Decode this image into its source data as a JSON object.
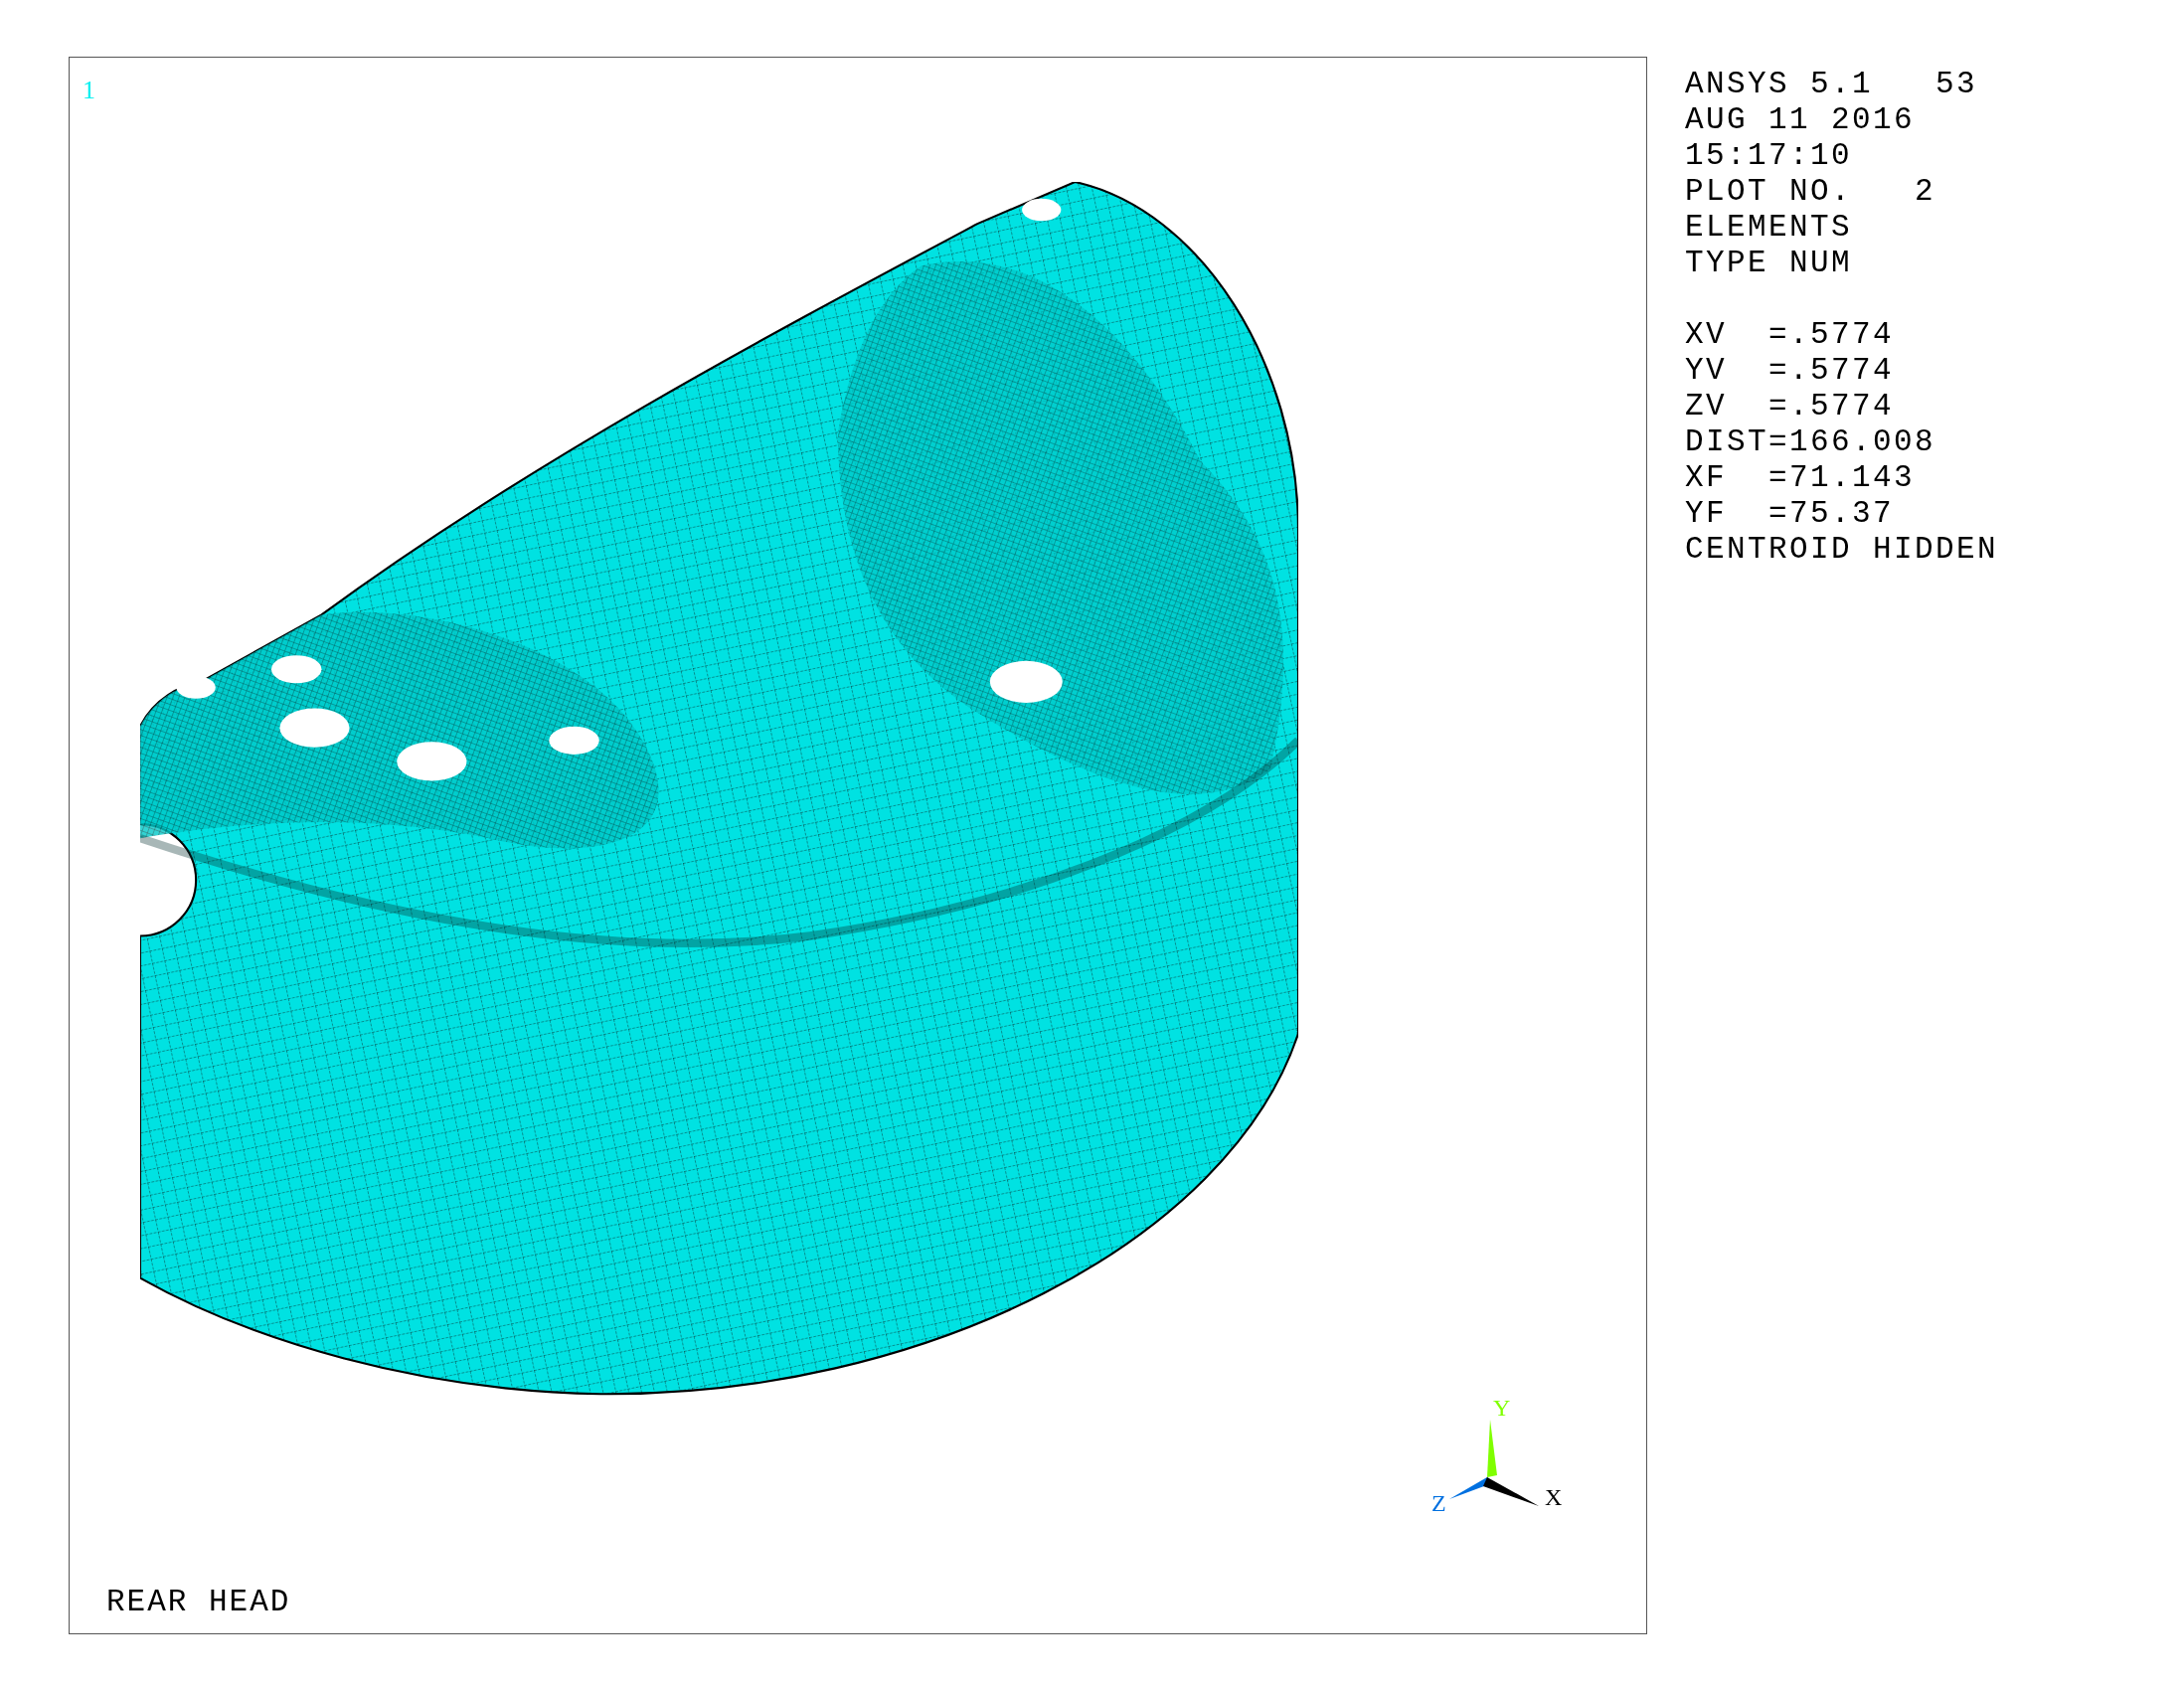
{
  "viewport_number": "1",
  "plot_title": "REAR HEAD",
  "info_groups": [
    [
      "ANSYS 5.1   53",
      "AUG 11 2016",
      "15:17:10",
      "PLOT NO.   2",
      "ELEMENTS",
      "TYPE NUM"
    ],
    [
      "XV  =.5774",
      "YV  =.5774",
      "ZV  =.5774",
      "DIST=166.008",
      "XF  =71.143",
      "YF  =75.37",
      "CENTROID HIDDEN"
    ]
  ],
  "triad": {
    "axes": [
      {
        "label": "Y",
        "color": "#80ff00"
      },
      {
        "label": "Z",
        "color": "#0070e0"
      },
      {
        "label": "X",
        "color": "#000000"
      }
    ]
  }
}
